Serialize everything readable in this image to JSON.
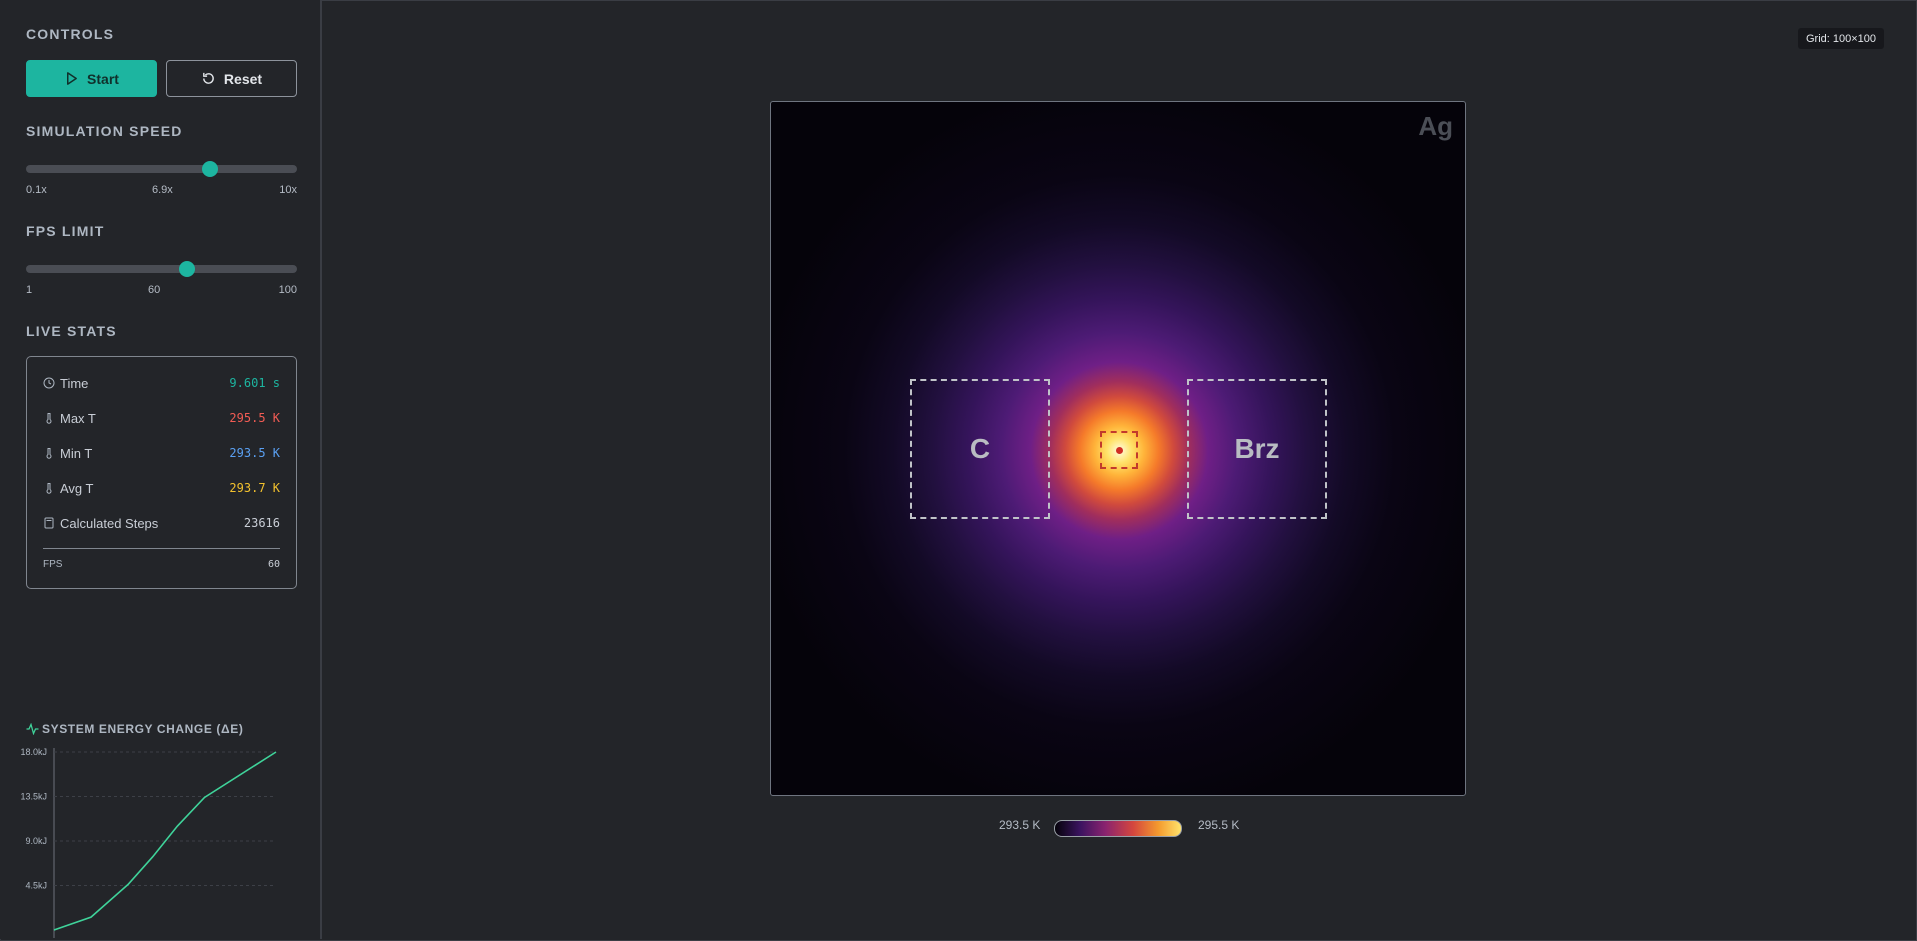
{
  "controls": {
    "title": "CONTROLS",
    "start_label": "Start",
    "reset_label": "Reset"
  },
  "speed": {
    "title": "SIMULATION SPEED",
    "min": "0.1x",
    "value": "6.9x",
    "max": "10x",
    "fraction": 0.68
  },
  "fps_limit": {
    "title": "FPS LIMIT",
    "min": "1",
    "value": "60",
    "max": "100",
    "fraction": 0.595
  },
  "stats": {
    "title": "LIVE STATS",
    "time_label": "Time",
    "time_value": "9.601 s",
    "max_label": "Max T",
    "max_value": "295.5 K",
    "min_label": "Min T",
    "min_value": "293.5 K",
    "avg_label": "Avg T",
    "avg_value": "293.7 K",
    "steps_label": "Calculated Steps",
    "steps_value": "23616",
    "fps_label": "FPS",
    "fps_value": "60",
    "colors": {
      "time": "#1db5a0",
      "max": "#f25c54",
      "min": "#5aa0f2",
      "avg": "#f2c12e"
    }
  },
  "energy": {
    "title": "SYSTEM ENERGY CHANGE (ΔE)"
  },
  "chart_data": {
    "type": "line",
    "title": "SYSTEM ENERGY CHANGE (ΔE)",
    "y_ticks": [
      "18.0kJ",
      "13.5kJ",
      "9.0kJ",
      "4.5kJ"
    ],
    "y_tick_values": [
      18.0,
      13.5,
      9.0,
      4.5
    ],
    "ylim": [
      0,
      18.0
    ],
    "x": [
      0,
      3,
      6,
      8,
      10,
      12.2,
      18
    ],
    "values": [
      0,
      1.3,
      4.6,
      7.4,
      10.5,
      13.4,
      18.0
    ],
    "xlim": [
      0,
      18
    ],
    "line_color": "#3fd39a",
    "grid": true
  },
  "grid_badge": "Grid: 100×100",
  "sim": {
    "material_label": "Ag",
    "zone_left_label": "C",
    "zone_right_label": "Brz"
  },
  "legend": {
    "min": "293.5 K",
    "max": "295.5 K"
  }
}
